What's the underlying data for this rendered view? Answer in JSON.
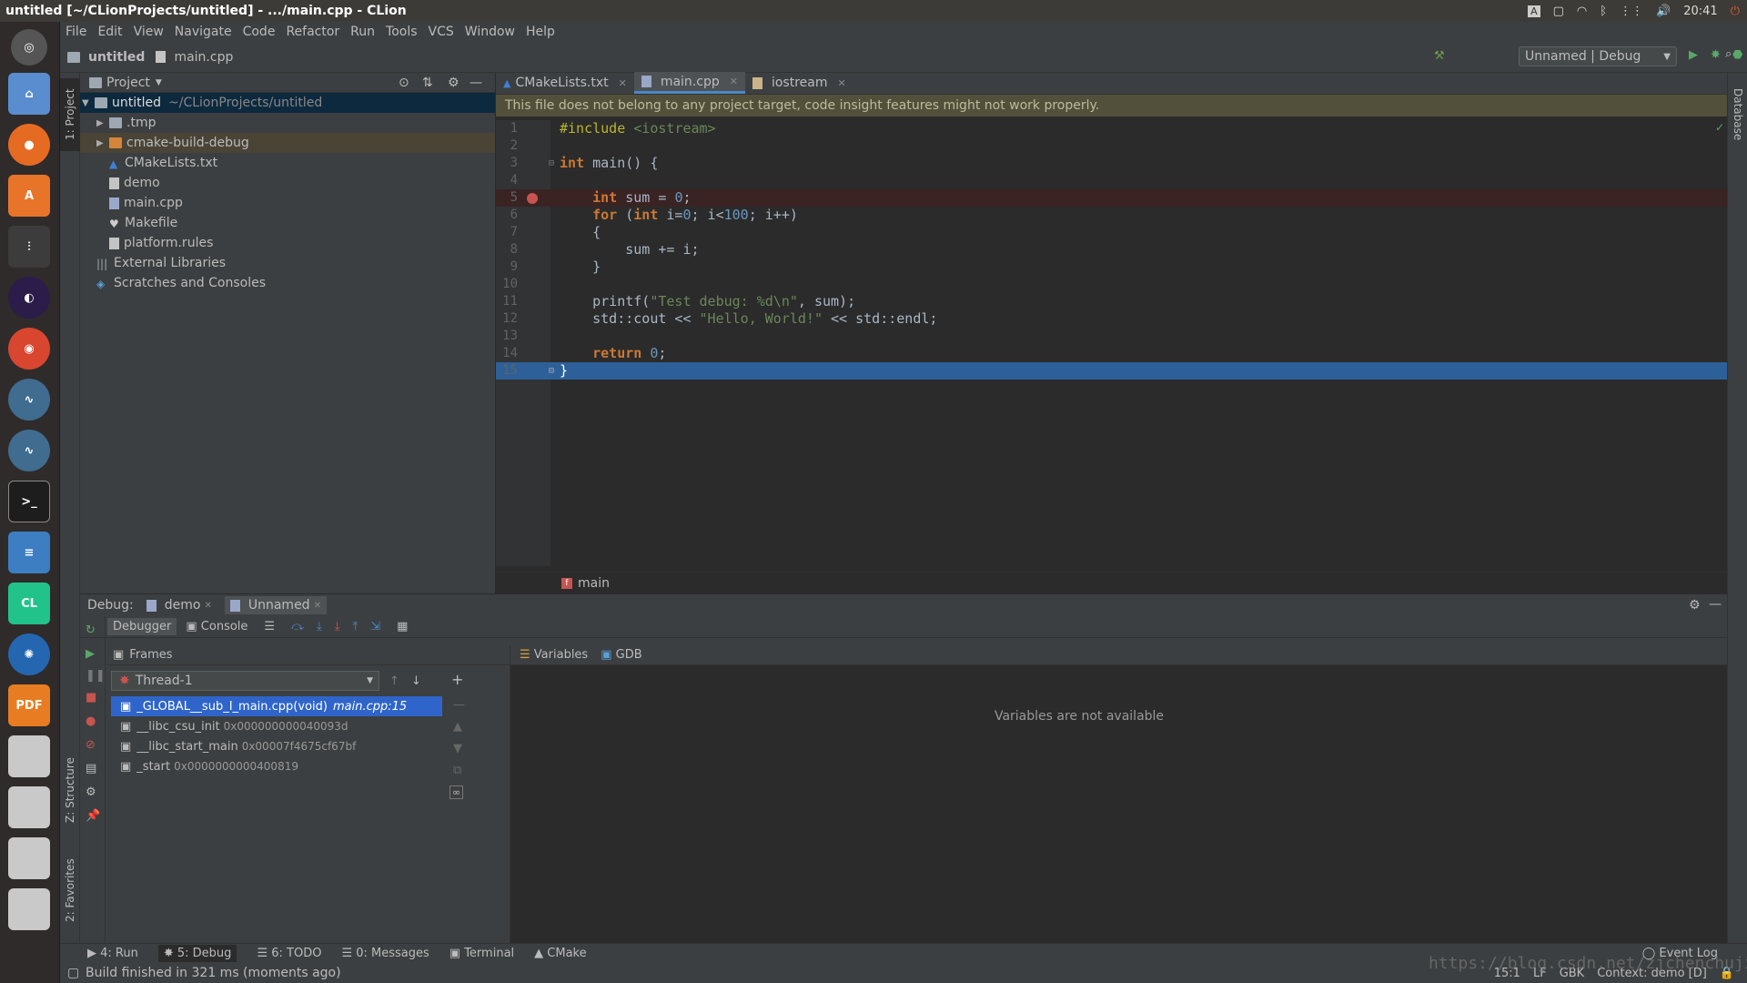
{
  "window": {
    "title": "untitled [~/CLionProjects/untitled] - .../main.cpp - CLion",
    "time": "20:41"
  },
  "menu": [
    "File",
    "Edit",
    "View",
    "Navigate",
    "Code",
    "Refactor",
    "Run",
    "Tools",
    "VCS",
    "Window",
    "Help"
  ],
  "breadcrumb": {
    "project": "untitled",
    "file": "main.cpp"
  },
  "run_config": "Unnamed | Debug",
  "project_panel": {
    "title": "Project",
    "root_name": "untitled",
    "root_path": "~/CLionProjects/untitled",
    "items": [
      {
        "label": ".tmp"
      },
      {
        "label": "cmake-build-debug"
      },
      {
        "label": "CMakeLists.txt"
      },
      {
        "label": "demo"
      },
      {
        "label": "main.cpp"
      },
      {
        "label": "Makefile"
      },
      {
        "label": "platform.rules"
      },
      {
        "label": "External Libraries"
      },
      {
        "label": "Scratches and Consoles"
      }
    ]
  },
  "left_tool_labels": {
    "project": "1: Project",
    "structure": "Z: Structure",
    "favorites": "2: Favorites"
  },
  "right_tool_labels": {
    "database": "Database"
  },
  "editor": {
    "tabs": [
      "CMakeLists.txt",
      "main.cpp",
      "iostream"
    ],
    "active_tab": "main.cpp",
    "warning": "This file does not belong to any project target, code insight features might not work properly.",
    "lines": [
      "1",
      "2",
      "3",
      "4",
      "5",
      "6",
      "7",
      "8",
      "9",
      "10",
      "11",
      "12",
      "13",
      "14",
      "15"
    ],
    "function_crumb": "main"
  },
  "debug": {
    "label": "Debug:",
    "sessions": [
      "demo",
      "Unnamed"
    ],
    "tabs": {
      "debugger": "Debugger",
      "console": "Console"
    },
    "frames_title": "Frames",
    "thread": "Thread-1",
    "frames": [
      {
        "name": "_GLOBAL__sub_I_main.cpp(void)",
        "loc": "main.cpp:15"
      },
      {
        "name": "__libc_csu_init",
        "loc": "0x000000000040093d"
      },
      {
        "name": "__libc_start_main",
        "loc": "0x00007f4675cf67bf"
      },
      {
        "name": "_start",
        "loc": "0x0000000000400819"
      }
    ],
    "variables_title": "Variables",
    "gdb_title": "GDB",
    "not_available": "Variables are not available"
  },
  "bottom_tabs": [
    "4: Run",
    "5: Debug",
    "6: TODO",
    "0: Messages",
    "Terminal",
    "CMake"
  ],
  "event_log": "Event Log",
  "status": {
    "message": "Build finished in 321 ms (moments ago)",
    "position": "15:1",
    "line_sep": "LF",
    "encoding": "GBK",
    "context": "Context: demo [D]"
  },
  "watermark": "https://blog.csdn.net/zjchenchujie"
}
